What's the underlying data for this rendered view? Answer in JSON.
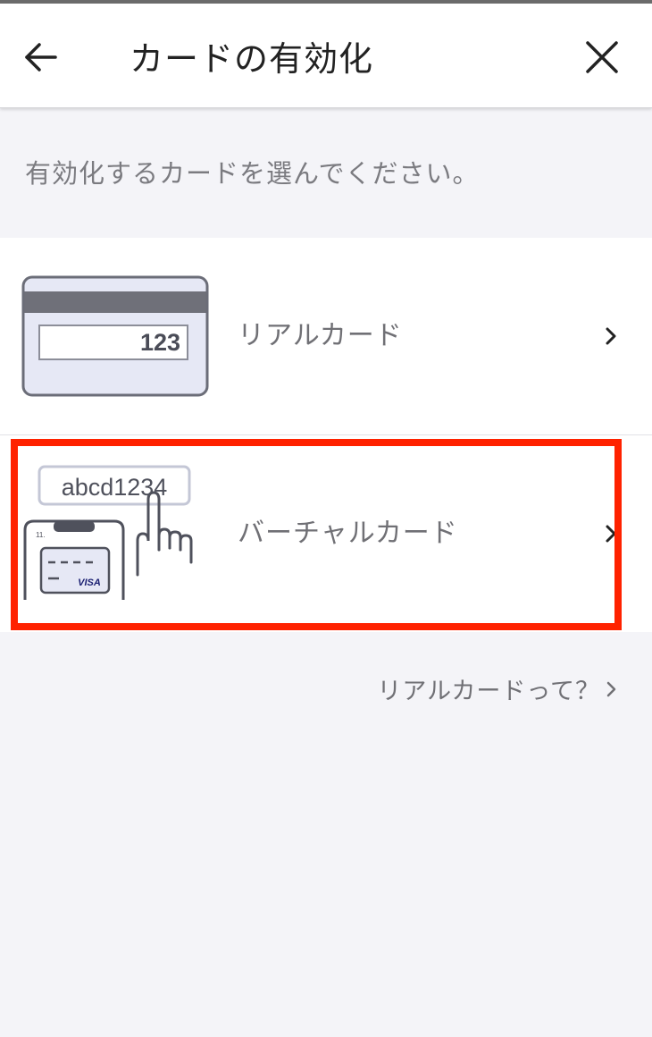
{
  "header": {
    "title": "カードの有効化",
    "back_icon": "arrow-left-icon",
    "close_icon": "close-icon"
  },
  "instruction": "有効化するカードを選んでください。",
  "cards": [
    {
      "label": "リアルカード",
      "thumb_icon": "physical-card-icon",
      "card_number_text": "123",
      "chevron_icon": "chevron-right-icon"
    },
    {
      "label": "バーチャルカード",
      "thumb_icon": "virtual-card-phone-icon",
      "code_text": "abcd1234",
      "visa_text": "VISA",
      "chevron_icon": "chevron-right-icon"
    }
  ],
  "help_link": {
    "label": "リアルカードって？",
    "chevron_icon": "chevron-right-icon"
  },
  "colors": {
    "background": "#f4f4f8",
    "highlight": "#ff2200",
    "text_secondary": "#707075"
  }
}
